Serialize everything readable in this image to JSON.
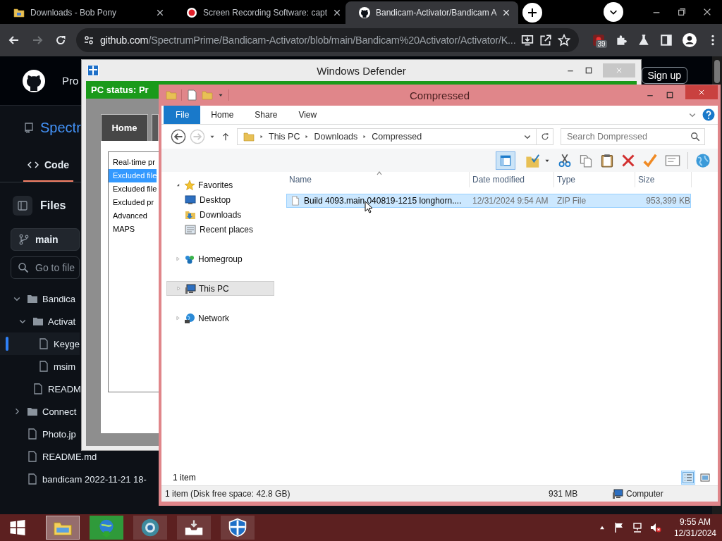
{
  "browser": {
    "tabs": [
      {
        "kind": "folder",
        "title": "Downloads - Bob Pony",
        "selected": false
      },
      {
        "kind": "record",
        "title": "Screen Recording Software: capt",
        "selected": false
      },
      {
        "kind": "github",
        "title": "Bandicam-Activator/Bandicam A",
        "selected": true
      }
    ],
    "url": {
      "host": "github.com",
      "path": "/SpectrumPrime/Bandicam-Activator/blob/main/Bandicam%20Activator/Activator/K..."
    },
    "extension_badge": "39"
  },
  "github": {
    "nav_item": "Pro",
    "sign_up": "Sign up",
    "repo_name": "Spectr",
    "code_tab": "Code",
    "files_title": "Files",
    "branch": "main",
    "file_search": {
      "placeholder": "Go to file"
    },
    "tree": [
      {
        "kind": "folder",
        "name": "Bandica",
        "expanded": true,
        "selected": false,
        "children": [
          {
            "kind": "folder",
            "name": "Activat",
            "expanded": true,
            "selected": false,
            "children": [
              {
                "kind": "file",
                "name": "Keyge",
                "selected": true
              },
              {
                "kind": "file",
                "name": "msim",
                "selected": false
              }
            ]
          },
          {
            "kind": "file",
            "name": "READM",
            "selected": false
          }
        ]
      },
      {
        "kind": "folder",
        "name": "Connect",
        "expanded": false,
        "selected": false
      },
      {
        "kind": "file",
        "name": "Photo.jp",
        "selected": false
      },
      {
        "kind": "file",
        "name": "README.md",
        "selected": false
      },
      {
        "kind": "file",
        "name": "bandicam 2022-11-21 18-",
        "selected": false
      }
    ]
  },
  "defender": {
    "title": "Windows Defender",
    "status": "PC status: Pr",
    "tabs": [
      {
        "label": "Home",
        "selected": true
      },
      {
        "selected": false
      }
    ],
    "settings": [
      {
        "label": "Real-time pr",
        "selected": false
      },
      {
        "label": "Excluded file",
        "selected": true
      },
      {
        "label": "Excluded file",
        "selected": false
      },
      {
        "label": "Excluded pr",
        "selected": false
      },
      {
        "label": "Advanced",
        "selected": false
      },
      {
        "label": "MAPS",
        "selected": false
      }
    ]
  },
  "explorer": {
    "title": "Compressed",
    "ribbon_tabs": [
      {
        "kind": "menu",
        "label": "File"
      },
      {
        "kind": "tab",
        "label": "Home"
      },
      {
        "kind": "tab",
        "label": "Share"
      },
      {
        "kind": "tab",
        "label": "View"
      }
    ],
    "breadcrumb": [
      "This PC",
      "Downloads",
      "Compressed"
    ],
    "search": {
      "placeholder": "Search Dompressed"
    },
    "nav": [
      {
        "kind": "favorites",
        "label": "Favorites",
        "expanded": true,
        "selected": false,
        "children": [
          {
            "kind": "desktop",
            "label": "Desktop",
            "selected": false
          },
          {
            "kind": "downloads",
            "label": "Downloads",
            "selected": false
          },
          {
            "kind": "recent",
            "label": "Recent places",
            "selected": false
          }
        ]
      },
      {
        "kind": "homegroup",
        "label": "Homegroup",
        "expanded": false,
        "selected": false
      },
      {
        "kind": "pc",
        "label": "This PC",
        "expanded": false,
        "selected": true
      },
      {
        "kind": "network",
        "label": "Network",
        "expanded": false,
        "selected": false
      }
    ],
    "columns": [
      "Name",
      "Date modified",
      "Type",
      "Size"
    ],
    "rows": [
      {
        "cells": [
          "Build 4093.main.040819-1215 longhorn....",
          "12/31/2024 9:54 AM",
          "ZIP File",
          "953,399 KB"
        ],
        "selected": true
      }
    ],
    "item_count": "1 item",
    "view_buttons": [
      {
        "kind": "details",
        "selected": true
      },
      {
        "kind": "tiles",
        "selected": false
      }
    ],
    "status": {
      "items": "1 item (Disk free space: 42.8 GB)",
      "size": "931 MB",
      "location": "Computer"
    }
  },
  "taskbar": {
    "apps": [
      {
        "kind": "explorer",
        "active": true
      },
      {
        "kind": "download-manager",
        "active": false
      },
      {
        "kind": "browser",
        "active": false
      },
      {
        "kind": "inbox",
        "active": false
      },
      {
        "kind": "defender",
        "active": false
      }
    ],
    "clock": {
      "time": "9:55 AM",
      "date": "12/31/2024"
    }
  }
}
